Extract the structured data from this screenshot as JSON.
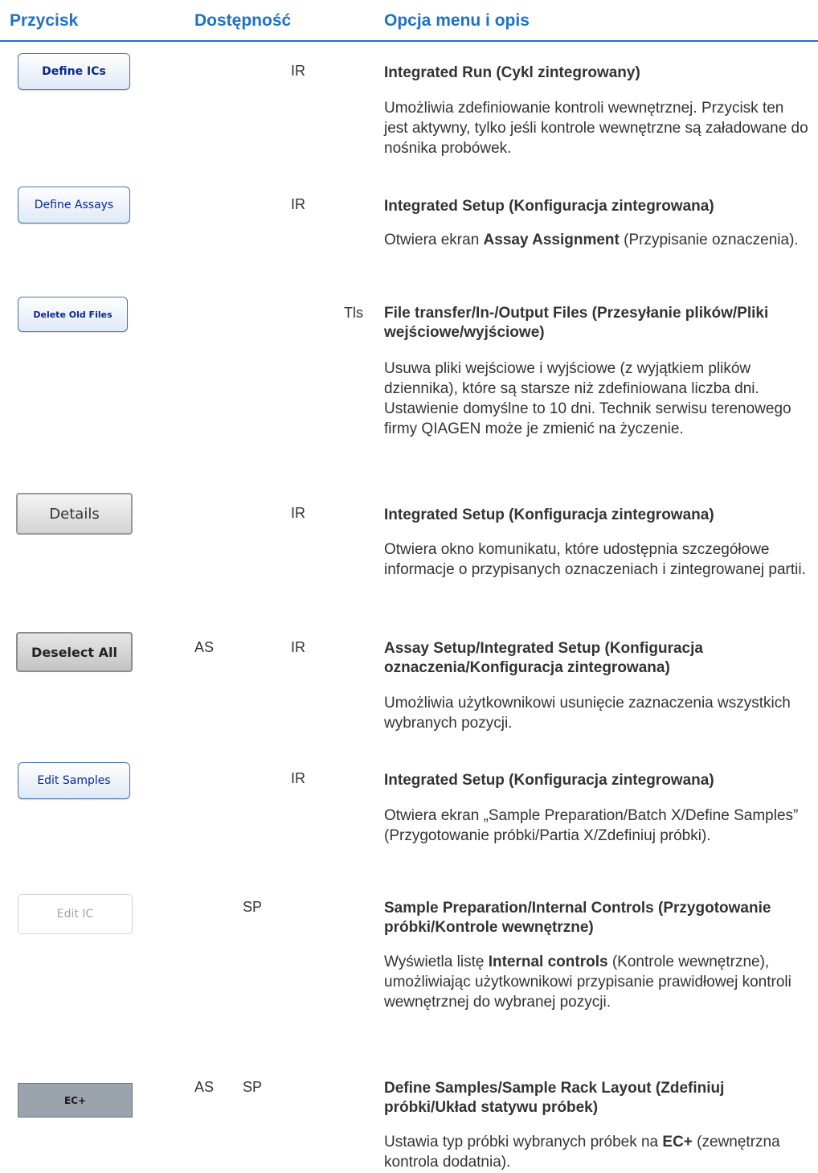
{
  "header": {
    "col_button": "Przycisk",
    "col_availability": "Dostępność",
    "col_menu": "Opcja menu i opis"
  },
  "rows": [
    {
      "button_label": "Define ICs",
      "avail": [
        "",
        "IR",
        ""
      ],
      "title": "Integrated Run (Cykl zintegrowany)",
      "desc": "Umożliwia zdefiniowanie kontroli wewnętrznej. Przycisk ten jest aktywny, tylko jeśli kontrole wewnętrzne są załadowane do nośnika probówek."
    },
    {
      "button_label": "Define Assays",
      "avail": [
        "",
        "IR",
        ""
      ],
      "title": "Integrated Setup (Konfiguracja zintegrowana)",
      "desc_prefix": "Otwiera ekran ",
      "desc_bold": "Assay Assignment",
      "desc_suffix": " (Przypisanie oznaczenia)."
    },
    {
      "button_label": "Delete Old Files",
      "avail": [
        "",
        "",
        "Tls"
      ],
      "title": "File transfer/In-/Output Files (Przesyłanie plików/Pliki wejściowe/wyjściowe)",
      "desc": "Usuwa pliki wejściowe i wyjściowe (z wyjątkiem plików dziennika), które są starsze niż zdefiniowana liczba dni. Ustawienie domyślne to 10 dni. Technik serwisu terenowego firmy QIAGEN może je zmienić na życzenie."
    },
    {
      "button_label": "Details",
      "avail": [
        "",
        "IR",
        ""
      ],
      "title": "Integrated Setup (Konfiguracja zintegrowana)",
      "desc": "Otwiera okno komunikatu, które udostępnia szczegółowe informacje o przypisanych oznaczeniach i zintegrowanej partii."
    },
    {
      "button_label": "Deselect All",
      "avail": [
        "AS",
        "IR",
        ""
      ],
      "title": "Assay Setup/Integrated Setup (Konfiguracja oznaczenia/Konfiguracja zintegrowana)",
      "desc": "Umożliwia użytkownikowi usunięcie zaznaczenia wszystkich wybranych pozycji."
    },
    {
      "button_label": "Edit Samples",
      "avail": [
        "",
        "IR",
        ""
      ],
      "title": "Integrated Setup (Konfiguracja zintegrowana)",
      "desc": "Otwiera ekran „Sample Preparation/Batch X/Define Samples” (Przygotowanie próbki/Partia X/Zdefiniuj próbki)."
    },
    {
      "button_label": "Edit IC",
      "avail": [
        "SP",
        "",
        ""
      ],
      "title": "Sample Preparation/Internal Controls (Przygotowanie próbki/Kontrole wewnętrzne)",
      "desc_prefix": "Wyświetla listę ",
      "desc_bold": "Internal controls",
      "desc_suffix": " (Kontrole wewnętrzne), umożliwiając użytkownikowi przypisanie prawidłowej kontroli wewnętrznej do wybranej pozycji."
    },
    {
      "button_label": "EC+",
      "avail": [
        "AS",
        "SP",
        ""
      ],
      "title": "Define Samples/Sample Rack Layout (Zdefiniuj próbki/Układ statywu próbek)",
      "desc_prefix": "Ustawia typ próbki wybranych próbek na ",
      "desc_bold": "EC+",
      "desc_suffix": " (zewnętrzna kontrola dodatnia)."
    }
  ]
}
